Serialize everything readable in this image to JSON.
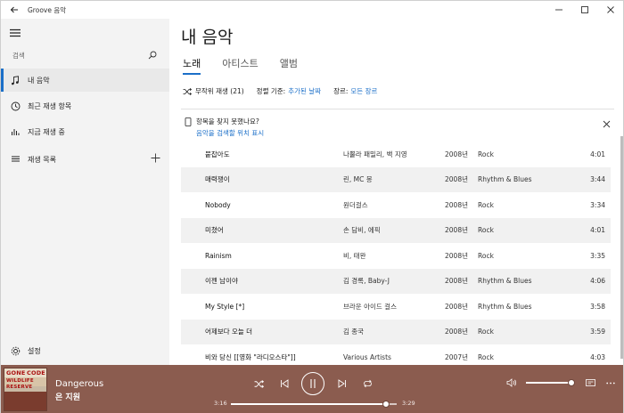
{
  "window": {
    "title": "Groove 음악"
  },
  "sidebar": {
    "search_placeholder": "검색",
    "items": [
      {
        "label": "내 음악",
        "icon": "music-note-icon"
      },
      {
        "label": "최근 재생 항목",
        "icon": "clock-icon"
      },
      {
        "label": "지금 재생 중",
        "icon": "equalizer-icon"
      },
      {
        "label": "재생 목록",
        "icon": "playlist-icon"
      }
    ],
    "settings_label": "설정"
  },
  "main": {
    "title": "내 음악",
    "tabs": [
      {
        "label": "노래",
        "active": true
      },
      {
        "label": "아티스트",
        "active": false
      },
      {
        "label": "앨범",
        "active": false
      }
    ],
    "shuffle_label": "무작위 재생 (21)",
    "sort_label": "정렬 기준:",
    "sort_value": "추가된 날짜",
    "genre_label": "장르:",
    "genre_value": "모든 장르",
    "notice": {
      "title": "항목을 찾지 못했나요?",
      "link": "음악을 검색할 위치 표시"
    },
    "songs": [
      {
        "title": "붙잡아도",
        "artist": "나뿔라 패밀리, 백 지영",
        "year": "2008년",
        "genre": "Rock",
        "duration": "4:01"
      },
      {
        "title": "매력쟁이",
        "artist": "린, MC 몽",
        "year": "2008년",
        "genre": "Rhythm & Blues",
        "duration": "3:44"
      },
      {
        "title": "Nobody",
        "artist": "원더걸스",
        "year": "2008년",
        "genre": "Rock",
        "duration": "3:34"
      },
      {
        "title": "미쳤어",
        "artist": "손 담비, 에픽",
        "year": "2008년",
        "genre": "Rock",
        "duration": "4:01"
      },
      {
        "title": "Rainism",
        "artist": "비, 태완",
        "year": "2008년",
        "genre": "Rock",
        "duration": "3:35"
      },
      {
        "title": "이젠 남이야",
        "artist": "김 경록, Baby-J",
        "year": "2008년",
        "genre": "Rhythm & Blues",
        "duration": "4:06"
      },
      {
        "title": "My Style [*]",
        "artist": "브라운 아이드 걸스",
        "year": "2008년",
        "genre": "Rhythm & Blues",
        "duration": "3:58"
      },
      {
        "title": "어제보다 오늘 더",
        "artist": "김 종국",
        "year": "2008년",
        "genre": "Rock",
        "duration": "3:59"
      },
      {
        "title": "비와 당신 [[영화 \"라디오스타\"]]",
        "artist": "Various Artists",
        "year": "2007년",
        "genre": "Rock",
        "duration": "4:03"
      }
    ]
  },
  "player": {
    "song_title": "Dangerous",
    "artist": "은 지원",
    "elapsed": "3:16",
    "total": "3:29",
    "progress": 0.9378,
    "volume": 1.0,
    "album_art_text": [
      "GONE",
      "CODE",
      "WILDLIFE",
      "RESERVE"
    ]
  },
  "colors": {
    "accent": "#1b6fc8",
    "player_bg": "#8b5c4f",
    "sidebar_bg": "#f3f3f3"
  }
}
